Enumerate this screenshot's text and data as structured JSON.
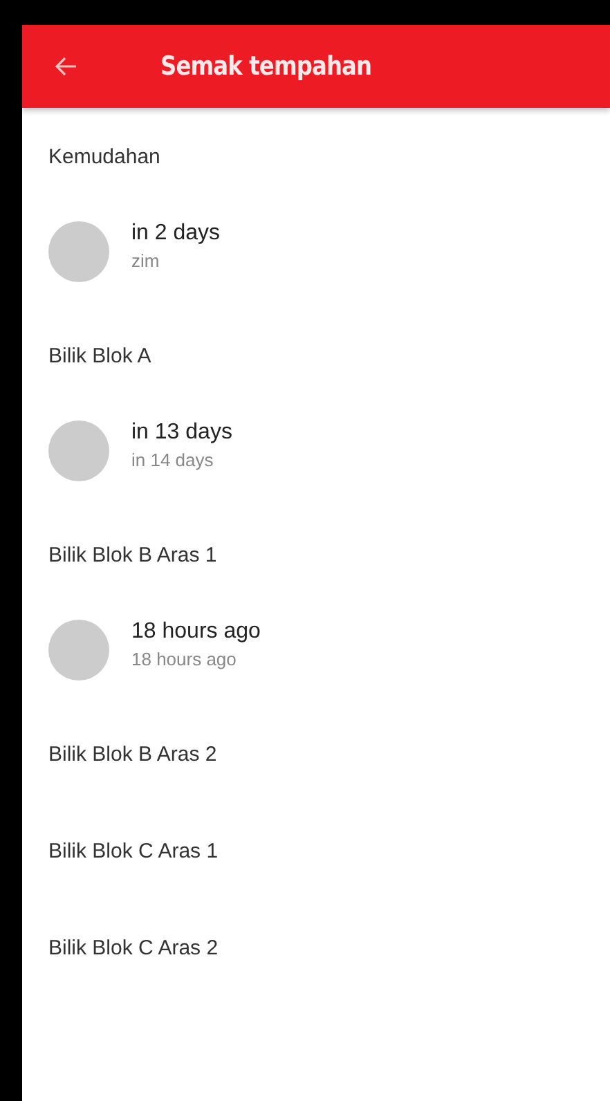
{
  "app_bar": {
    "title": "Semak tempahan"
  },
  "sections": [
    {
      "title": "Kemudahan",
      "items": [
        {
          "title": "in 2 days",
          "subtitle": "zim"
        }
      ]
    },
    {
      "title": "Bilik Blok A",
      "items": [
        {
          "title": "in 13 days",
          "subtitle": "in 14 days"
        }
      ]
    },
    {
      "title": "Bilik Blok B Aras 1",
      "items": [
        {
          "title": "18 hours ago",
          "subtitle": "18 hours ago"
        }
      ]
    },
    {
      "title": "Bilik Blok B Aras 2"
    },
    {
      "title": "Bilik Blok C Aras 1"
    },
    {
      "title": "Bilik Blok C Aras 2"
    }
  ]
}
